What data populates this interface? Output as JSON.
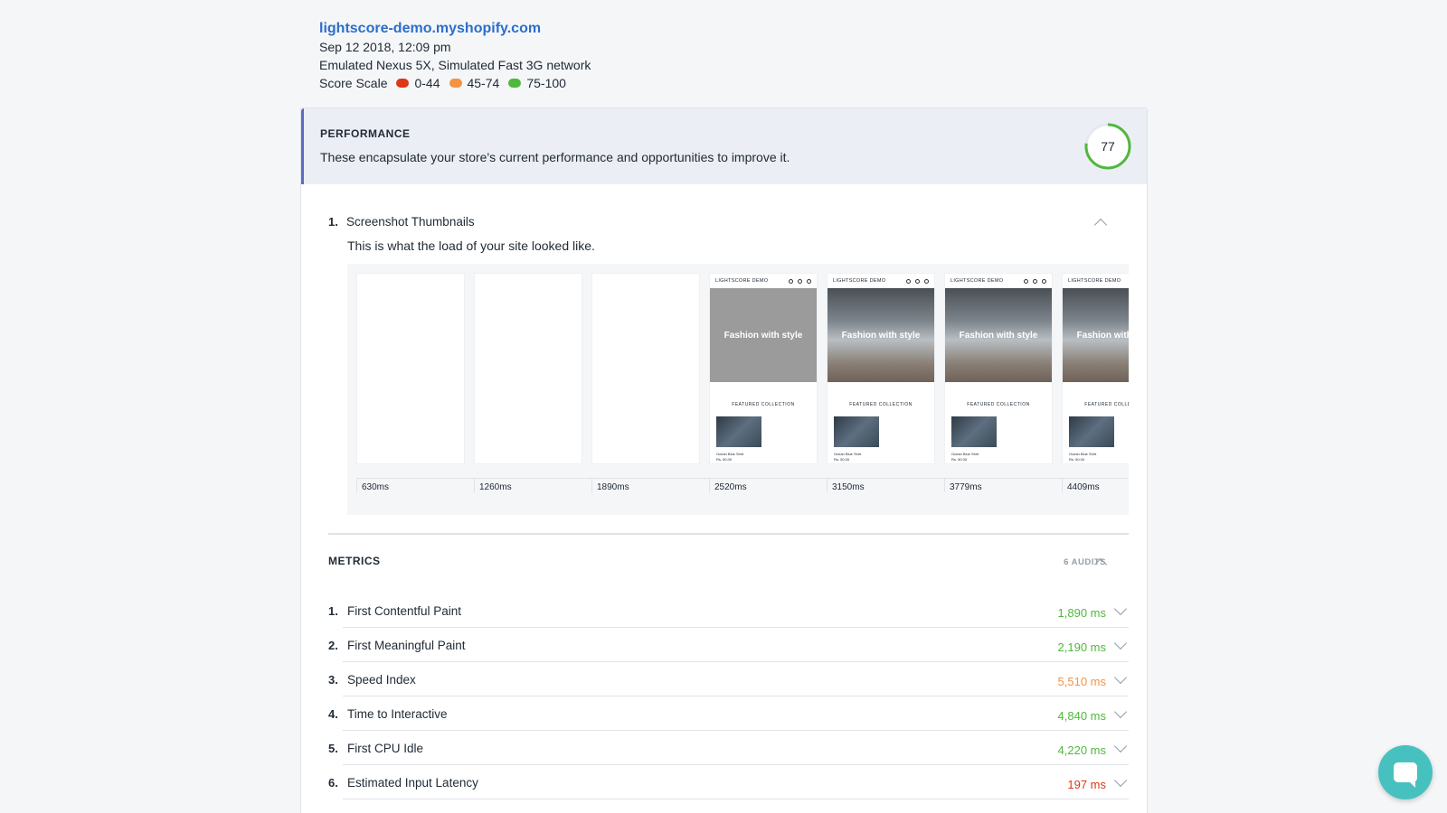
{
  "header": {
    "site": "lightscore-demo.myshopify.com",
    "date": "Sep 12 2018, 12:09 pm",
    "device": "Emulated Nexus 5X, Simulated Fast 3G network",
    "scale_label": "Score Scale",
    "scale": [
      {
        "label": "0-44",
        "color": "#de3618"
      },
      {
        "label": "45-74",
        "color": "#f49342"
      },
      {
        "label": "75-100",
        "color": "#50b83c"
      }
    ]
  },
  "performance": {
    "title": "PERFORMANCE",
    "description": "These encapsulate your store's current performance and opportunities to improve it.",
    "score": "77",
    "score_fraction": 0.77,
    "score_color": "#50b83c"
  },
  "thumbnails": {
    "number": "1.",
    "title": "Screenshot Thumbnails",
    "subtitle": "This is what the load of your site looked like.",
    "frame_store_name": "LIGHTSCORE DEMO",
    "frame_hero_text": "Fashion with style",
    "frame_collection": "FEATURED COLLECTION",
    "frame_product": "Ocean Blue Shirt",
    "frame_price": "Rs. 50.00",
    "times": [
      "630ms",
      "1260ms",
      "1890ms",
      "2520ms",
      "3150ms",
      "3779ms",
      "4409ms"
    ]
  },
  "metrics": {
    "title": "METRICS",
    "count": "6 AUDITS",
    "items": [
      {
        "num": "1.",
        "name": "First Contentful Paint",
        "value": "1,890 ms",
        "color": "#50b83c"
      },
      {
        "num": "2.",
        "name": "First Meaningful Paint",
        "value": "2,190 ms",
        "color": "#50b83c"
      },
      {
        "num": "3.",
        "name": "Speed Index",
        "value": "5,510 ms",
        "color": "#f49342"
      },
      {
        "num": "4.",
        "name": "Time to Interactive",
        "value": "4,840 ms",
        "color": "#50b83c"
      },
      {
        "num": "5.",
        "name": "First CPU Idle",
        "value": "4,220 ms",
        "color": "#50b83c"
      },
      {
        "num": "6.",
        "name": "Estimated Input Latency",
        "value": "197 ms",
        "color": "#de3618"
      }
    ]
  }
}
